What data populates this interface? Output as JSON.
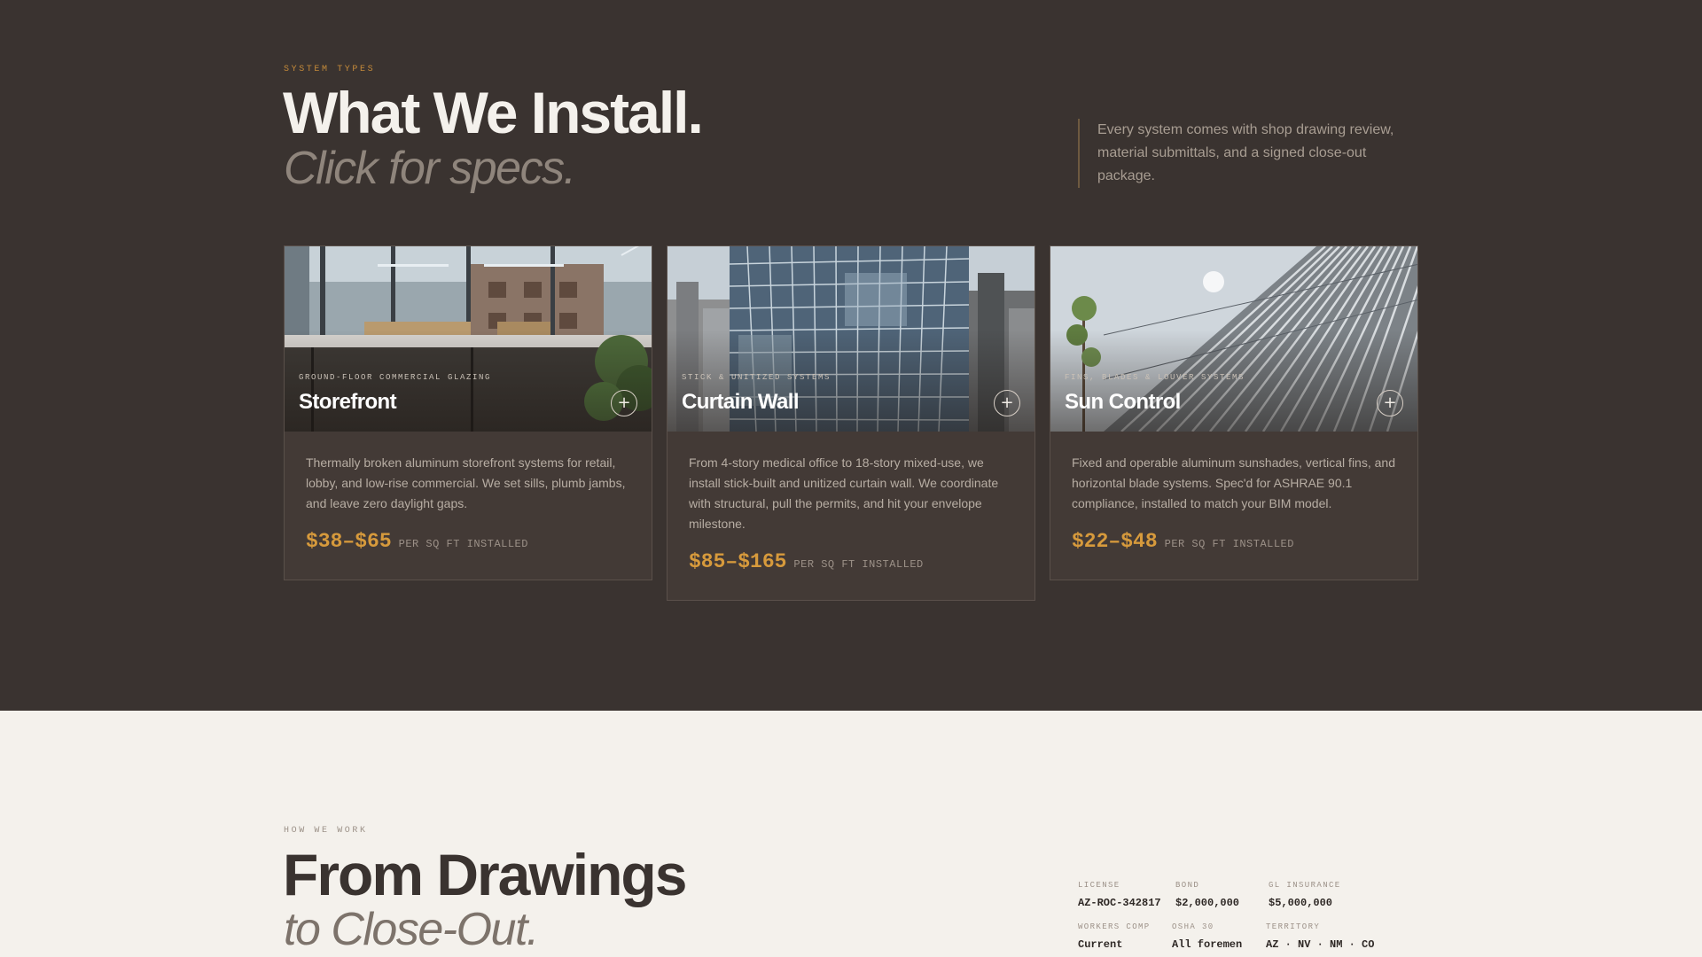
{
  "systems": {
    "eyebrow": "SYSTEM TYPES",
    "title": "What We Install.",
    "subtitle": "Click for specs.",
    "note": [
      "Every system comes with shop drawing review,",
      "material submittals, and a signed close-out",
      "package."
    ],
    "cards": [
      {
        "tag": "GROUND-FLOOR COMMERCIAL GLAZING",
        "title": "Storefront",
        "toggle": "+",
        "desc": [
          "Thermally broken aluminum storefront systems for retail,",
          "lobby, and low-rise commercial. We set sills, plumb jambs,",
          "and leave zero daylight gaps."
        ],
        "price": "$38–$65",
        "unit": "PER SQ FT INSTALLED"
      },
      {
        "tag": "STICK & UNITIZED SYSTEMS",
        "title": "Curtain Wall",
        "toggle": "+",
        "desc": [
          "From 4-story medical office to 18-story mixed-use, we",
          "install stick-built and unitized curtain wall. We coordinate",
          "with structural, pull the permits, and hit your envelope",
          "milestone."
        ],
        "price": "$85–$165",
        "unit": "PER SQ FT INSTALLED"
      },
      {
        "tag": "FINS, BLADES & LOUVER SYSTEMS",
        "title": "Sun Control",
        "toggle": "+",
        "desc": [
          "Fixed and operable aluminum sunshades, vertical fins, and",
          "horizontal blade systems. Spec'd for ASHRAE 90.1",
          "compliance, installed to match your BIM model."
        ],
        "price": "$22–$48",
        "unit": "PER SQ FT INSTALLED"
      }
    ]
  },
  "process": {
    "eyebrow": "HOW WE WORK",
    "title": "From Drawings",
    "subtitle": "to Close-Out."
  },
  "credentials": [
    {
      "label": "LICENSE",
      "value": "AZ-ROC-342817"
    },
    {
      "label": "BOND",
      "value": "$2,000,000"
    },
    {
      "label": "GL INSURANCE",
      "value": "$5,000,000"
    },
    {
      "label": "WORKERS COMP",
      "value": "Current"
    },
    {
      "label": "OSHA 30",
      "value": "All foremen"
    },
    {
      "label": "TERRITORY",
      "value": "AZ · NV · NM · CO"
    }
  ],
  "colors": {
    "dark_bg": "#3a3330",
    "light_bg": "#f4f1ec",
    "accent": "#d79a3c",
    "card_bg": "#433a36"
  }
}
